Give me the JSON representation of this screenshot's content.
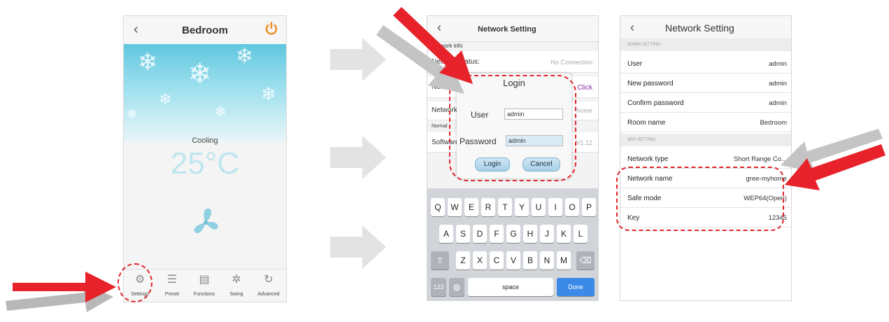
{
  "screen1": {
    "title": "Bedroom",
    "back": "‹",
    "mode": "Cooling",
    "temperature": "25°C",
    "tabs": [
      {
        "label": "Settings",
        "icon": "gear-icon"
      },
      {
        "label": "Preset",
        "icon": "list-icon"
      },
      {
        "label": "Functions",
        "icon": "functions-icon"
      },
      {
        "label": "Swing",
        "icon": "swing-icon"
      },
      {
        "label": "Advanced",
        "icon": "advanced-icon"
      }
    ],
    "colors": {
      "power": "#f08a1c",
      "sky": "#5fc7de"
    }
  },
  "screen2": {
    "title": "Network Setting",
    "back": "‹",
    "bg": {
      "network_info": "Network info",
      "network_status": "Network status:",
      "status_value": "No Connection",
      "network_label": "Network",
      "click": "Click",
      "network_name": "Network name",
      "name_value": "home",
      "normal": "Normal",
      "software": "Software",
      "software_value": "V1.12"
    },
    "dialog": {
      "title": "Login",
      "user_label": "User",
      "user_value": "admin",
      "password_label": "Password",
      "password_value": "admin",
      "login": "Login",
      "cancel": "Cancel"
    },
    "keyboard": {
      "row1": [
        "Q",
        "W",
        "E",
        "R",
        "T",
        "Y",
        "U",
        "I",
        "O",
        "P"
      ],
      "row2": [
        "A",
        "S",
        "D",
        "F",
        "G",
        "H",
        "J",
        "K",
        "L"
      ],
      "row3": [
        "Z",
        "X",
        "C",
        "V",
        "B",
        "N",
        "M"
      ],
      "num": "123",
      "space": "space",
      "done": "Done"
    }
  },
  "screen3": {
    "title": "Network Setting",
    "back": "‹",
    "admin_section": "ADMIN SETTING",
    "wifi_section": "WIFI SETTING",
    "admin_rows": [
      {
        "key": "User",
        "value": "admin"
      },
      {
        "key": "New password",
        "value": "admin"
      },
      {
        "key": "Confirm password",
        "value": "admin"
      },
      {
        "key": "Room name",
        "value": "Bedroom"
      }
    ],
    "wifi_rows": [
      {
        "key": "Network type",
        "value": "Short Range Co..."
      },
      {
        "key": "Network name",
        "value": "gree-myhome"
      },
      {
        "key": "Safe mode",
        "value": "WEP64(Open)"
      },
      {
        "key": "Key",
        "value": "12345"
      }
    ]
  },
  "colors": {
    "callout_red": "#e8222a",
    "arrow_gray": "#e2e2e2",
    "link_purple": "#8a2b9e"
  }
}
